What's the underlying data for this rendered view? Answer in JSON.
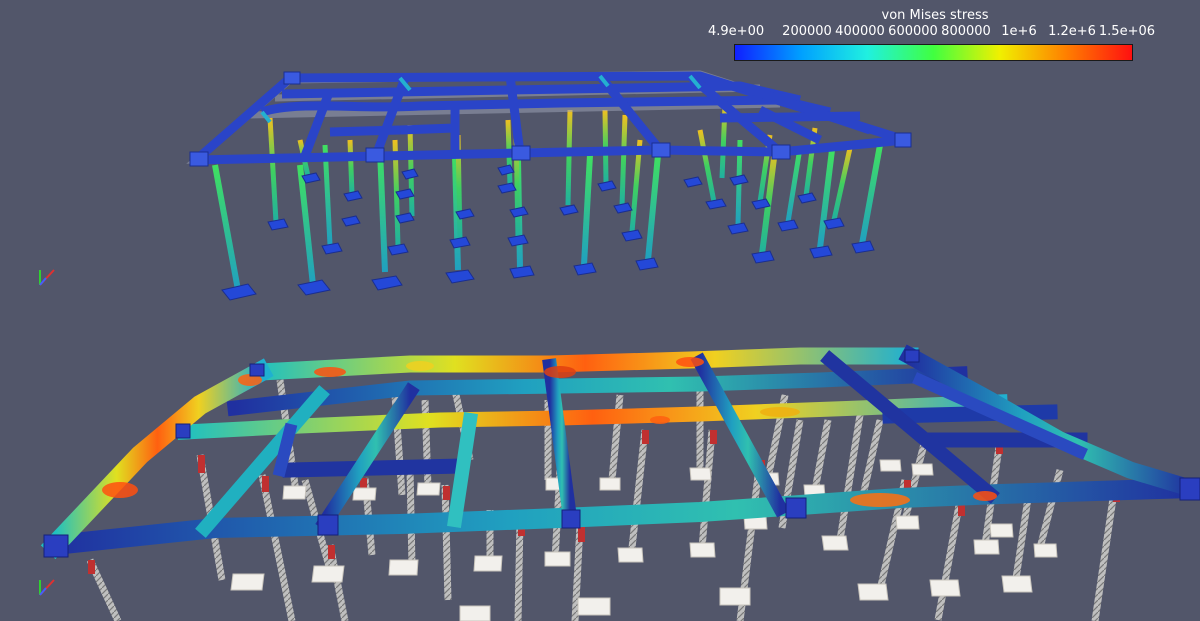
{
  "colorbar": {
    "title": "von Mises stress",
    "ticks": [
      "4.9e+00",
      "200000",
      "400000",
      "600000",
      "800000",
      "1e+6",
      "1.2e+6",
      "1.5e+06"
    ],
    "range": [
      4.9,
      1500000
    ],
    "colormap": [
      "#1020ff",
      "#00a0ff",
      "#20f0e0",
      "#40ff40",
      "#f0f000",
      "#ff8000",
      "#ff1010"
    ]
  },
  "colors": {
    "background": "#52566a",
    "low_stress": "#2a3aa8",
    "high_stress": "#e04010",
    "undeformed_footing": "#f2f2f2"
  }
}
